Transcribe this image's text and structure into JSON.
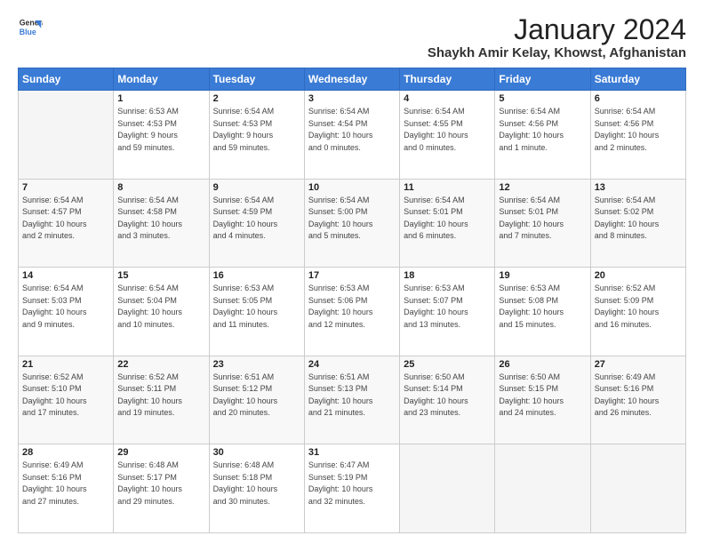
{
  "logo": {
    "line1": "General",
    "line2": "Blue"
  },
  "title": "January 2024",
  "subtitle": "Shaykh Amir Kelay, Khowst, Afghanistan",
  "weekdays": [
    "Sunday",
    "Monday",
    "Tuesday",
    "Wednesday",
    "Thursday",
    "Friday",
    "Saturday"
  ],
  "weeks": [
    [
      {
        "day": "",
        "info": ""
      },
      {
        "day": "1",
        "info": "Sunrise: 6:53 AM\nSunset: 4:53 PM\nDaylight: 9 hours\nand 59 minutes."
      },
      {
        "day": "2",
        "info": "Sunrise: 6:54 AM\nSunset: 4:53 PM\nDaylight: 9 hours\nand 59 minutes."
      },
      {
        "day": "3",
        "info": "Sunrise: 6:54 AM\nSunset: 4:54 PM\nDaylight: 10 hours\nand 0 minutes."
      },
      {
        "day": "4",
        "info": "Sunrise: 6:54 AM\nSunset: 4:55 PM\nDaylight: 10 hours\nand 0 minutes."
      },
      {
        "day": "5",
        "info": "Sunrise: 6:54 AM\nSunset: 4:56 PM\nDaylight: 10 hours\nand 1 minute."
      },
      {
        "day": "6",
        "info": "Sunrise: 6:54 AM\nSunset: 4:56 PM\nDaylight: 10 hours\nand 2 minutes."
      }
    ],
    [
      {
        "day": "7",
        "info": "Sunrise: 6:54 AM\nSunset: 4:57 PM\nDaylight: 10 hours\nand 2 minutes."
      },
      {
        "day": "8",
        "info": "Sunrise: 6:54 AM\nSunset: 4:58 PM\nDaylight: 10 hours\nand 3 minutes."
      },
      {
        "day": "9",
        "info": "Sunrise: 6:54 AM\nSunset: 4:59 PM\nDaylight: 10 hours\nand 4 minutes."
      },
      {
        "day": "10",
        "info": "Sunrise: 6:54 AM\nSunset: 5:00 PM\nDaylight: 10 hours\nand 5 minutes."
      },
      {
        "day": "11",
        "info": "Sunrise: 6:54 AM\nSunset: 5:01 PM\nDaylight: 10 hours\nand 6 minutes."
      },
      {
        "day": "12",
        "info": "Sunrise: 6:54 AM\nSunset: 5:01 PM\nDaylight: 10 hours\nand 7 minutes."
      },
      {
        "day": "13",
        "info": "Sunrise: 6:54 AM\nSunset: 5:02 PM\nDaylight: 10 hours\nand 8 minutes."
      }
    ],
    [
      {
        "day": "14",
        "info": "Sunrise: 6:54 AM\nSunset: 5:03 PM\nDaylight: 10 hours\nand 9 minutes."
      },
      {
        "day": "15",
        "info": "Sunrise: 6:54 AM\nSunset: 5:04 PM\nDaylight: 10 hours\nand 10 minutes."
      },
      {
        "day": "16",
        "info": "Sunrise: 6:53 AM\nSunset: 5:05 PM\nDaylight: 10 hours\nand 11 minutes."
      },
      {
        "day": "17",
        "info": "Sunrise: 6:53 AM\nSunset: 5:06 PM\nDaylight: 10 hours\nand 12 minutes."
      },
      {
        "day": "18",
        "info": "Sunrise: 6:53 AM\nSunset: 5:07 PM\nDaylight: 10 hours\nand 13 minutes."
      },
      {
        "day": "19",
        "info": "Sunrise: 6:53 AM\nSunset: 5:08 PM\nDaylight: 10 hours\nand 15 minutes."
      },
      {
        "day": "20",
        "info": "Sunrise: 6:52 AM\nSunset: 5:09 PM\nDaylight: 10 hours\nand 16 minutes."
      }
    ],
    [
      {
        "day": "21",
        "info": "Sunrise: 6:52 AM\nSunset: 5:10 PM\nDaylight: 10 hours\nand 17 minutes."
      },
      {
        "day": "22",
        "info": "Sunrise: 6:52 AM\nSunset: 5:11 PM\nDaylight: 10 hours\nand 19 minutes."
      },
      {
        "day": "23",
        "info": "Sunrise: 6:51 AM\nSunset: 5:12 PM\nDaylight: 10 hours\nand 20 minutes."
      },
      {
        "day": "24",
        "info": "Sunrise: 6:51 AM\nSunset: 5:13 PM\nDaylight: 10 hours\nand 21 minutes."
      },
      {
        "day": "25",
        "info": "Sunrise: 6:50 AM\nSunset: 5:14 PM\nDaylight: 10 hours\nand 23 minutes."
      },
      {
        "day": "26",
        "info": "Sunrise: 6:50 AM\nSunset: 5:15 PM\nDaylight: 10 hours\nand 24 minutes."
      },
      {
        "day": "27",
        "info": "Sunrise: 6:49 AM\nSunset: 5:16 PM\nDaylight: 10 hours\nand 26 minutes."
      }
    ],
    [
      {
        "day": "28",
        "info": "Sunrise: 6:49 AM\nSunset: 5:16 PM\nDaylight: 10 hours\nand 27 minutes."
      },
      {
        "day": "29",
        "info": "Sunrise: 6:48 AM\nSunset: 5:17 PM\nDaylight: 10 hours\nand 29 minutes."
      },
      {
        "day": "30",
        "info": "Sunrise: 6:48 AM\nSunset: 5:18 PM\nDaylight: 10 hours\nand 30 minutes."
      },
      {
        "day": "31",
        "info": "Sunrise: 6:47 AM\nSunset: 5:19 PM\nDaylight: 10 hours\nand 32 minutes."
      },
      {
        "day": "",
        "info": ""
      },
      {
        "day": "",
        "info": ""
      },
      {
        "day": "",
        "info": ""
      }
    ]
  ]
}
